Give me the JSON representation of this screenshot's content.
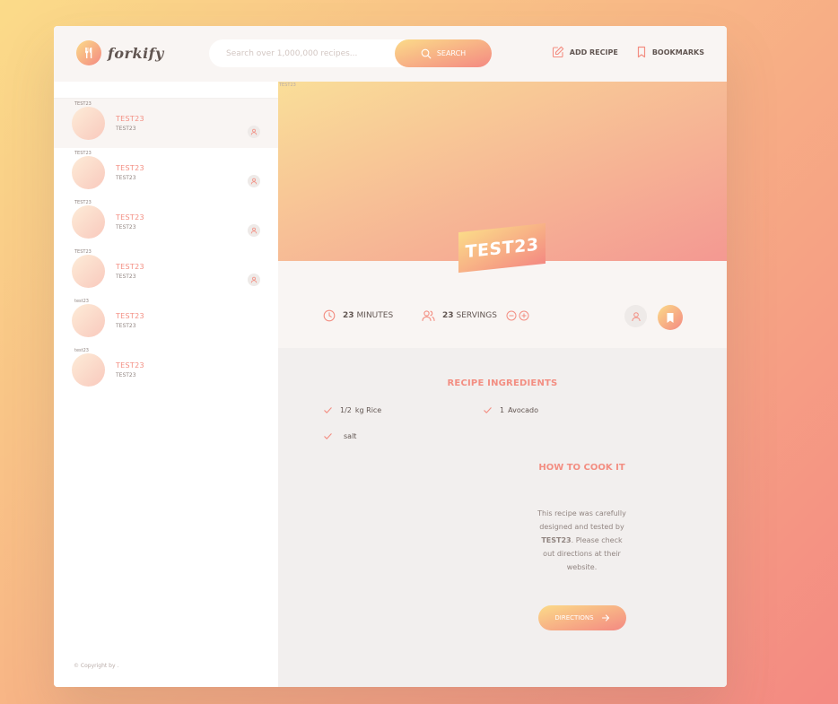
{
  "header": {
    "logo_text": "forkify",
    "search_placeholder": "Search over 1,000,000 recipes...",
    "search_button": "SEARCH",
    "add_recipe": "ADD RECIPE",
    "bookmarks": "BOOKMARKS"
  },
  "results": [
    {
      "alt": "TEST23",
      "title": "TEST23",
      "publisher": "TEST23",
      "user_generated": true,
      "active": true
    },
    {
      "alt": "TEST23",
      "title": "TEST23",
      "publisher": "TEST23",
      "user_generated": true,
      "active": false
    },
    {
      "alt": "TEST23",
      "title": "TEST23",
      "publisher": "TEST23",
      "user_generated": true,
      "active": false
    },
    {
      "alt": "TEST23",
      "title": "TEST23",
      "publisher": "TEST23",
      "user_generated": true,
      "active": false
    },
    {
      "alt": "test23",
      "title": "TEST23",
      "publisher": "TEST23",
      "user_generated": false,
      "active": false
    },
    {
      "alt": "test23",
      "title": "TEST23",
      "publisher": "TEST23",
      "user_generated": false,
      "active": false
    }
  ],
  "copyright": "© Copyright by .",
  "recipe": {
    "image_alt": "TEST23",
    "title": "TEST23",
    "minutes": "23",
    "minutes_label": "MINUTES",
    "servings": "23",
    "servings_label": "SERVINGS",
    "ingredients_heading": "RECIPE INGREDIENTS",
    "ingredients": [
      {
        "quantity": "1/2",
        "description": "kg Rice"
      },
      {
        "quantity": "1",
        "description": "Avocado"
      },
      {
        "quantity": "",
        "description": "salt"
      }
    ],
    "cook_heading": "HOW TO COOK IT",
    "cook_text_1": "This recipe was carefully designed and tested by",
    "publisher": "TEST23",
    "cook_text_2": ". Please check out directions at their website.",
    "directions_button": "DIRECTIONS"
  },
  "colors": {
    "accent_start": "#fbdb89",
    "accent_end": "#f48982",
    "primary": "#f38e82",
    "text": "#615551"
  }
}
